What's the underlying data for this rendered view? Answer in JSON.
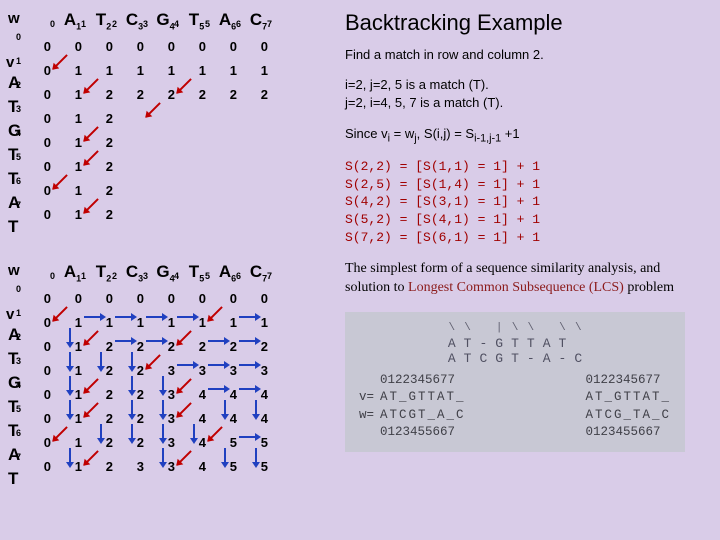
{
  "title": "Backtracking Example",
  "intro": "Find a match in row and column 2.",
  "lines": [
    "i=2, j=2, 5 is a match (T).",
    "j=2, i=4, 5, 7 is a match (T)."
  ],
  "since": "Since vi = wj, S(i,j) = Si-1,j-1 +1",
  "equations": [
    "S(2,2) = [S(1,1) = 1] + 1",
    "S(2,5) = [S(1,4) = 1] + 1",
    "S(4,2) = [S(3,1) = 1] + 1",
    "S(5,2) = [S(4,1) = 1] + 1",
    "S(7,2) = [S(6,1) = 1] + 1"
  ],
  "paragraph_pre": "The simplest form of a sequence similarity analysis, and solution to ",
  "paragraph_lcs": "Longest Common Subsequence (LCS)",
  "paragraph_post": " problem",
  "align": {
    "row1": [
      "A",
      "T",
      "-",
      "G",
      "T",
      "T",
      "A",
      "T"
    ],
    "row2": [
      "A",
      "T",
      "C",
      "G",
      "T",
      "-",
      "A",
      "-",
      "C"
    ],
    "top_left": "0122345677",
    "top_right": "0122345677",
    "vline": "AT_GTTAT_",
    "wline": "ATCGT_A_C",
    "v_right": "AT_GTTAT_",
    "w_right": "ATCG_TA_C",
    "bot_left": "0123455667",
    "bot_right": "0123455667",
    "vlab": "v=",
    "wlab": "w="
  },
  "w_seq": [
    "A",
    "T",
    "C",
    "G",
    "T",
    "A",
    "C"
  ],
  "v_seq": [
    "A",
    "T",
    "G",
    "T",
    "T",
    "A",
    "T"
  ],
  "w_label": "w",
  "v_label": "v",
  "chart_data": [
    {
      "type": "table",
      "title": "Backtracking matrix 1 (diagonal arrows on matches)",
      "w": [
        "",
        "A",
        "T",
        "C",
        "G",
        "T",
        "A",
        "C"
      ],
      "v": [
        "",
        "A",
        "T",
        "G",
        "T",
        "T",
        "A",
        "T"
      ],
      "rows": [
        [
          0,
          0,
          0,
          0,
          0,
          0,
          0,
          0
        ],
        [
          0,
          1,
          1,
          1,
          1,
          1,
          1,
          1
        ],
        [
          0,
          1,
          2,
          2,
          2,
          2,
          2,
          2
        ],
        [
          0,
          1,
          2,
          null,
          null,
          null,
          null,
          null
        ],
        [
          0,
          1,
          2,
          null,
          null,
          null,
          null,
          null
        ],
        [
          0,
          1,
          2,
          null,
          null,
          null,
          null,
          null
        ],
        [
          0,
          1,
          2,
          null,
          null,
          null,
          null,
          null
        ],
        [
          0,
          1,
          2,
          null,
          null,
          null,
          null,
          null
        ]
      ]
    },
    {
      "type": "table",
      "title": "Backtracking matrix 2 (full DP with backtrack arrows)",
      "w": [
        "",
        "A",
        "T",
        "C",
        "G",
        "T",
        "A",
        "C"
      ],
      "v": [
        "",
        "A",
        "T",
        "G",
        "T",
        "T",
        "A",
        "T"
      ],
      "rows": [
        [
          0,
          0,
          0,
          0,
          0,
          0,
          0,
          0
        ],
        [
          0,
          1,
          1,
          1,
          1,
          1,
          1,
          1
        ],
        [
          0,
          1,
          2,
          2,
          2,
          2,
          2,
          2
        ],
        [
          0,
          1,
          2,
          2,
          3,
          3,
          3,
          3
        ],
        [
          0,
          1,
          2,
          2,
          3,
          4,
          4,
          4
        ],
        [
          0,
          1,
          2,
          2,
          3,
          4,
          4,
          4
        ],
        [
          0,
          1,
          2,
          2,
          3,
          4,
          5,
          5
        ],
        [
          0,
          1,
          2,
          3,
          3,
          4,
          5,
          5
        ]
      ]
    }
  ]
}
